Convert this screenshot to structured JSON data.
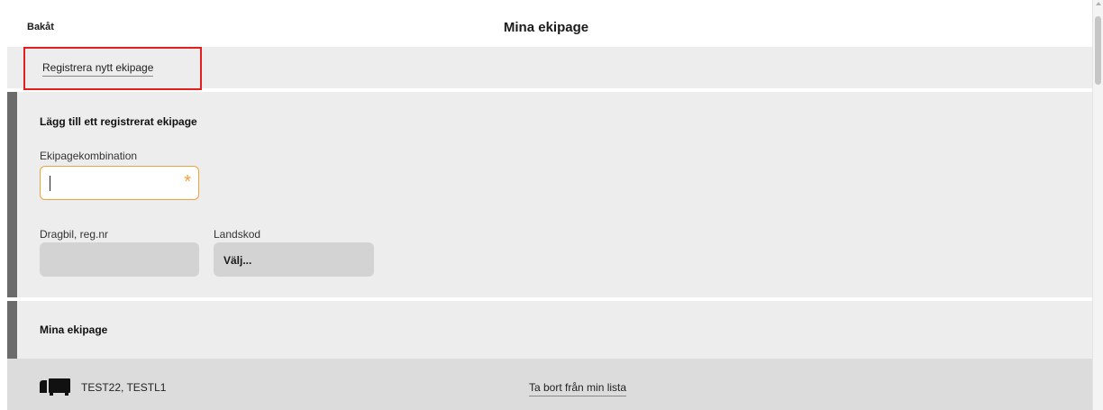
{
  "header": {
    "back_label": "Bakåt",
    "title": "Mina ekipage"
  },
  "register": {
    "link_label": "Registrera nytt ekipage",
    "highlight_color": "#e41e1e"
  },
  "add_form": {
    "heading": "Lägg till ett registrerat ekipage",
    "combination_label": "Ekipagekombination",
    "combination_value": "",
    "required_marker": "*",
    "tractor_label": "Dragbil, reg.nr",
    "tractor_value": "",
    "country_label": "Landskod",
    "country_value": "Välj..."
  },
  "my_list": {
    "heading": "Mina ekipage",
    "items": [
      {
        "label": "TEST22, TESTL1",
        "icon": "truck-icon",
        "action_label": "Ta bort från min lista"
      }
    ]
  },
  "colors": {
    "accent_bar": "#6b6b6b",
    "focus_border": "#f0a23a",
    "panel_bg": "#ededed"
  }
}
